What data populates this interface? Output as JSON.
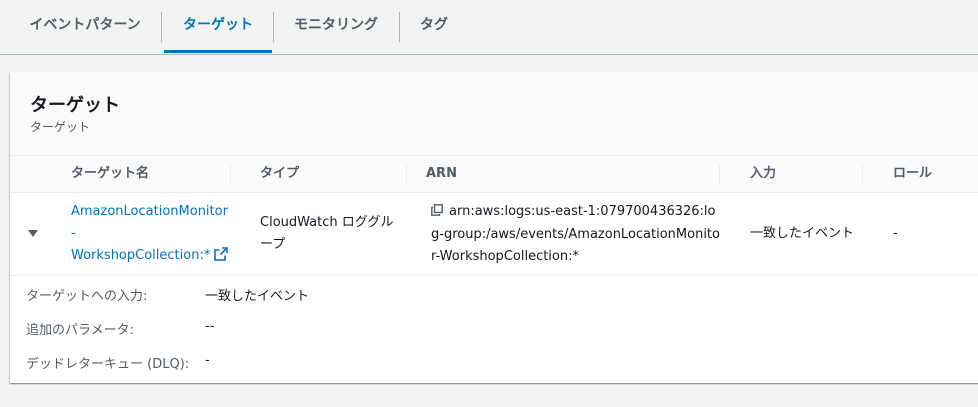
{
  "tabs": [
    {
      "label": "イベントパターン"
    },
    {
      "label": "ターゲット"
    },
    {
      "label": "モニタリング"
    },
    {
      "label": "タグ"
    }
  ],
  "panel": {
    "title": "ターゲット",
    "description": "ターゲット"
  },
  "table": {
    "columns": [
      "ターゲット名",
      "タイプ",
      "ARN",
      "入力",
      "ロール"
    ],
    "row": {
      "name_lines": [
        "AmazonLocationMonitor",
        "-",
        "WorkshopCollection:*"
      ],
      "type_lines": [
        "CloudWatch ロググル",
        "ープ"
      ],
      "arn_lines": [
        "arn:aws:logs:us-east-1:079700436326:lo",
        "g-group:/aws/events/AmazonLocationMonito",
        "r-WorkshopCollection:*"
      ],
      "input": "一致したイベント",
      "role": "-"
    }
  },
  "details": [
    {
      "label": "ターゲットへの入力:",
      "value": "一致したイベント"
    },
    {
      "label": "追加のパラメータ:",
      "value": "--"
    },
    {
      "label": "デッドレターキュー (DLQ):",
      "value": "-"
    }
  ],
  "colors": {
    "accent": "#0073bb",
    "text": "#16191f",
    "muted": "#545b64"
  }
}
